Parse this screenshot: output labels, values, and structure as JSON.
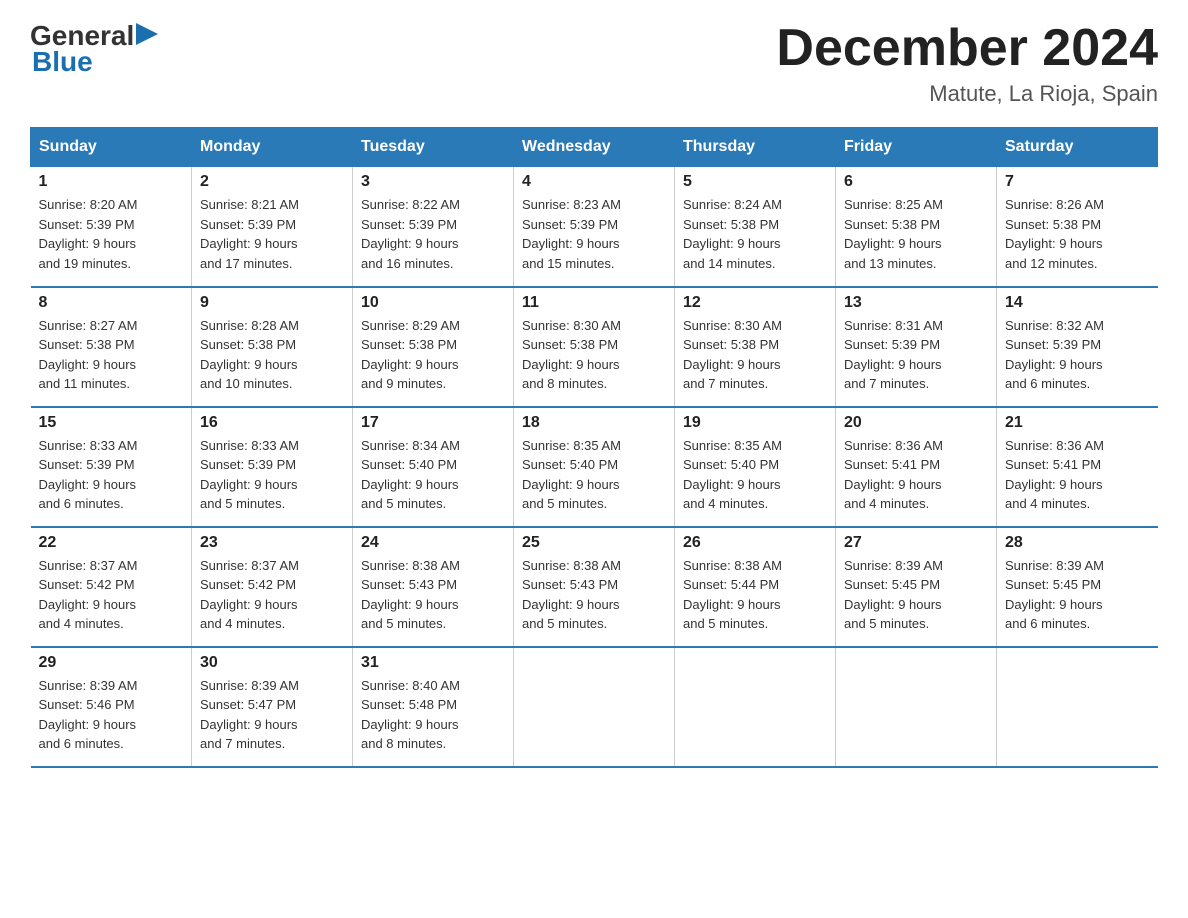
{
  "header": {
    "logo_general": "General",
    "logo_blue": "Blue",
    "title": "December 2024",
    "location": "Matute, La Rioja, Spain"
  },
  "calendar": {
    "days_of_week": [
      "Sunday",
      "Monday",
      "Tuesday",
      "Wednesday",
      "Thursday",
      "Friday",
      "Saturday"
    ],
    "weeks": [
      [
        {
          "day": "1",
          "info": "Sunrise: 8:20 AM\nSunset: 5:39 PM\nDaylight: 9 hours\nand 19 minutes."
        },
        {
          "day": "2",
          "info": "Sunrise: 8:21 AM\nSunset: 5:39 PM\nDaylight: 9 hours\nand 17 minutes."
        },
        {
          "day": "3",
          "info": "Sunrise: 8:22 AM\nSunset: 5:39 PM\nDaylight: 9 hours\nand 16 minutes."
        },
        {
          "day": "4",
          "info": "Sunrise: 8:23 AM\nSunset: 5:39 PM\nDaylight: 9 hours\nand 15 minutes."
        },
        {
          "day": "5",
          "info": "Sunrise: 8:24 AM\nSunset: 5:38 PM\nDaylight: 9 hours\nand 14 minutes."
        },
        {
          "day": "6",
          "info": "Sunrise: 8:25 AM\nSunset: 5:38 PM\nDaylight: 9 hours\nand 13 minutes."
        },
        {
          "day": "7",
          "info": "Sunrise: 8:26 AM\nSunset: 5:38 PM\nDaylight: 9 hours\nand 12 minutes."
        }
      ],
      [
        {
          "day": "8",
          "info": "Sunrise: 8:27 AM\nSunset: 5:38 PM\nDaylight: 9 hours\nand 11 minutes."
        },
        {
          "day": "9",
          "info": "Sunrise: 8:28 AM\nSunset: 5:38 PM\nDaylight: 9 hours\nand 10 minutes."
        },
        {
          "day": "10",
          "info": "Sunrise: 8:29 AM\nSunset: 5:38 PM\nDaylight: 9 hours\nand 9 minutes."
        },
        {
          "day": "11",
          "info": "Sunrise: 8:30 AM\nSunset: 5:38 PM\nDaylight: 9 hours\nand 8 minutes."
        },
        {
          "day": "12",
          "info": "Sunrise: 8:30 AM\nSunset: 5:38 PM\nDaylight: 9 hours\nand 7 minutes."
        },
        {
          "day": "13",
          "info": "Sunrise: 8:31 AM\nSunset: 5:39 PM\nDaylight: 9 hours\nand 7 minutes."
        },
        {
          "day": "14",
          "info": "Sunrise: 8:32 AM\nSunset: 5:39 PM\nDaylight: 9 hours\nand 6 minutes."
        }
      ],
      [
        {
          "day": "15",
          "info": "Sunrise: 8:33 AM\nSunset: 5:39 PM\nDaylight: 9 hours\nand 6 minutes."
        },
        {
          "day": "16",
          "info": "Sunrise: 8:33 AM\nSunset: 5:39 PM\nDaylight: 9 hours\nand 5 minutes."
        },
        {
          "day": "17",
          "info": "Sunrise: 8:34 AM\nSunset: 5:40 PM\nDaylight: 9 hours\nand 5 minutes."
        },
        {
          "day": "18",
          "info": "Sunrise: 8:35 AM\nSunset: 5:40 PM\nDaylight: 9 hours\nand 5 minutes."
        },
        {
          "day": "19",
          "info": "Sunrise: 8:35 AM\nSunset: 5:40 PM\nDaylight: 9 hours\nand 4 minutes."
        },
        {
          "day": "20",
          "info": "Sunrise: 8:36 AM\nSunset: 5:41 PM\nDaylight: 9 hours\nand 4 minutes."
        },
        {
          "day": "21",
          "info": "Sunrise: 8:36 AM\nSunset: 5:41 PM\nDaylight: 9 hours\nand 4 minutes."
        }
      ],
      [
        {
          "day": "22",
          "info": "Sunrise: 8:37 AM\nSunset: 5:42 PM\nDaylight: 9 hours\nand 4 minutes."
        },
        {
          "day": "23",
          "info": "Sunrise: 8:37 AM\nSunset: 5:42 PM\nDaylight: 9 hours\nand 4 minutes."
        },
        {
          "day": "24",
          "info": "Sunrise: 8:38 AM\nSunset: 5:43 PM\nDaylight: 9 hours\nand 5 minutes."
        },
        {
          "day": "25",
          "info": "Sunrise: 8:38 AM\nSunset: 5:43 PM\nDaylight: 9 hours\nand 5 minutes."
        },
        {
          "day": "26",
          "info": "Sunrise: 8:38 AM\nSunset: 5:44 PM\nDaylight: 9 hours\nand 5 minutes."
        },
        {
          "day": "27",
          "info": "Sunrise: 8:39 AM\nSunset: 5:45 PM\nDaylight: 9 hours\nand 5 minutes."
        },
        {
          "day": "28",
          "info": "Sunrise: 8:39 AM\nSunset: 5:45 PM\nDaylight: 9 hours\nand 6 minutes."
        }
      ],
      [
        {
          "day": "29",
          "info": "Sunrise: 8:39 AM\nSunset: 5:46 PM\nDaylight: 9 hours\nand 6 minutes."
        },
        {
          "day": "30",
          "info": "Sunrise: 8:39 AM\nSunset: 5:47 PM\nDaylight: 9 hours\nand 7 minutes."
        },
        {
          "day": "31",
          "info": "Sunrise: 8:40 AM\nSunset: 5:48 PM\nDaylight: 9 hours\nand 8 minutes."
        },
        {
          "day": "",
          "info": ""
        },
        {
          "day": "",
          "info": ""
        },
        {
          "day": "",
          "info": ""
        },
        {
          "day": "",
          "info": ""
        }
      ]
    ]
  }
}
